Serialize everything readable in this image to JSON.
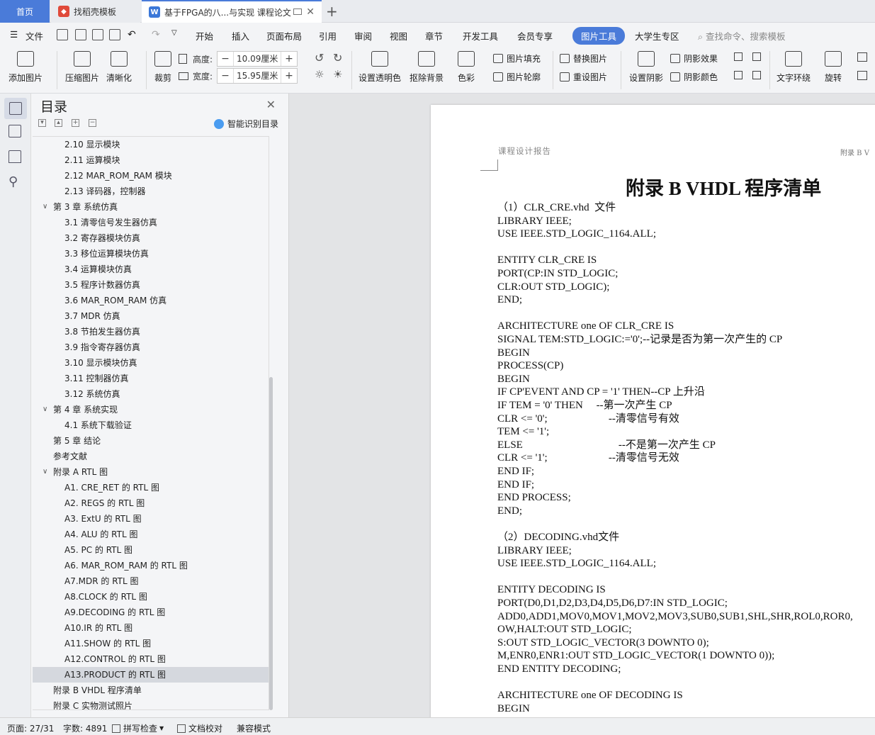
{
  "tabs": {
    "home": "首页",
    "doc1": "找稻壳模板",
    "doc2": "基于FPGA的八...与实现 课程论文",
    "add": "+"
  },
  "menu": {
    "file": "文件",
    "items": [
      "开始",
      "插入",
      "页面布局",
      "引用",
      "审阅",
      "视图",
      "章节",
      "开发工具",
      "会员专享",
      "图片工具",
      "大学生专区"
    ],
    "search": "查找命令、搜索模板"
  },
  "ribbon": {
    "add_image": "添加图片",
    "compress": "压缩图片",
    "sharpen": "清晰化",
    "crop": "裁剪",
    "height_label": "高度:",
    "height_value": "10.09厘米",
    "width_label": "宽度:",
    "width_value": "15.95厘米",
    "transparent": "设置透明色",
    "remove_bg": "抠除背景",
    "color": "色彩",
    "fill": "图片填充",
    "outline": "图片轮廓",
    "replace": "替换图片",
    "reset": "重设图片",
    "shadow_set": "设置阴影",
    "shadow_effect": "阴影效果",
    "shadow_color": "阴影颜色",
    "wrap": "文字环绕",
    "rotate": "旋转"
  },
  "toc": {
    "title": "目录",
    "smart": "智能识别目录",
    "items": [
      {
        "label": "2.10  显示模块",
        "level": 2
      },
      {
        "label": "2.11  运算模块",
        "level": 2
      },
      {
        "label": "2.12 MAR_ROM_RAM 模块",
        "level": 2
      },
      {
        "label": "2.13  译码器，控制器",
        "level": 2
      },
      {
        "label": "第 3 章  系统仿真",
        "level": 1,
        "caret": "∨"
      },
      {
        "label": "3.1  清零信号发生器仿真",
        "level": 2
      },
      {
        "label": "3.2  寄存器模块仿真",
        "level": 2
      },
      {
        "label": "3.3  移位运算模块仿真",
        "level": 2
      },
      {
        "label": "3.4 运算模块仿真",
        "level": 2
      },
      {
        "label": "3.5 程序计数器仿真",
        "level": 2
      },
      {
        "label": "3.6 MAR_ROM_RAM 仿真",
        "level": 2
      },
      {
        "label": "3.7 MDR 仿真",
        "level": 2
      },
      {
        "label": "3.8  节拍发生器仿真",
        "level": 2
      },
      {
        "label": "3.9  指令寄存器仿真",
        "level": 2
      },
      {
        "label": "3.10  显示模块仿真",
        "level": 2
      },
      {
        "label": "3.11  控制器仿真",
        "level": 2
      },
      {
        "label": "3.12 系统仿真",
        "level": 2
      },
      {
        "label": "第 4 章  系统实现",
        "level": 1,
        "caret": "∨"
      },
      {
        "label": "4.1  系统下载验证",
        "level": 2
      },
      {
        "label": "第 5 章  结论",
        "level": 1
      },
      {
        "label": "参考文献",
        "level": 1
      },
      {
        "label": "附录 A RTL 图",
        "level": 1,
        "caret": "∨"
      },
      {
        "label": "A1. CRE_RET 的 RTL 图",
        "level": 2
      },
      {
        "label": "A2. REGS 的 RTL 图",
        "level": 2
      },
      {
        "label": "A3. ExtU 的 RTL 图",
        "level": 2
      },
      {
        "label": "A4. ALU 的 RTL 图",
        "level": 2
      },
      {
        "label": "A5. PC 的 RTL 图",
        "level": 2
      },
      {
        "label": "A6. MAR_ROM_RAM 的 RTL 图",
        "level": 2
      },
      {
        "label": "A7.MDR 的 RTL 图",
        "level": 2
      },
      {
        "label": "A8.CLOCK 的 RTL 图",
        "level": 2
      },
      {
        "label": "A9.DECODING 的 RTL 图",
        "level": 2
      },
      {
        "label": "A10.IR 的 RTL 图",
        "level": 2
      },
      {
        "label": "A11.SHOW 的 RTL 图",
        "level": 2
      },
      {
        "label": "A12.CONTROL 的 RTL 图",
        "level": 2
      },
      {
        "label": "A13.PRODUCT 的 RTL 图",
        "level": 2,
        "selected": true
      },
      {
        "label": "附录 B VHDL 程序清单",
        "level": 1
      },
      {
        "label": "附录 C  实物测试照片",
        "level": 1
      }
    ]
  },
  "document": {
    "header_left": "课程设计报告",
    "header_right": "附录 B   V",
    "title": "附录 B VHDL 程序清单",
    "lines": [
      "（1）CLR_CRE.vhd  文件",
      "LIBRARY IEEE;",
      "USE IEEE.STD_LOGIC_1164.ALL;",
      "",
      "ENTITY CLR_CRE IS",
      "PORT(CP:IN STD_LOGIC;",
      "CLR:OUT STD_LOGIC);",
      "END;",
      "",
      "ARCHITECTURE one OF CLR_CRE IS",
      "SIGNAL TEM:STD_LOGIC:='0';--记录是否为第一次产生的 CP",
      "BEGIN",
      "PROCESS(CP)",
      "BEGIN",
      "IF CP'EVENT AND CP = '1' THEN--CP 上升沿",
      "IF TEM = '0' THEN     --第一次产生 CP",
      "CLR <= '0';                       --清零信号有效",
      "TEM <= '1';",
      "ELSE                                    --不是第一次产生 CP",
      "CLR <= '1';                       --清零信号无效",
      "END IF;",
      "END IF;",
      "END PROCESS;",
      "END;",
      "",
      "（2）DECODING.vhd文件",
      "LIBRARY IEEE;",
      "USE IEEE.STD_LOGIC_1164.ALL;",
      "",
      "ENTITY DECODING IS",
      "PORT(D0,D1,D2,D3,D4,D5,D6,D7:IN STD_LOGIC;",
      "ADD0,ADD1,MOV0,MOV1,MOV2,MOV3,SUB0,SUB1,SHL,SHR,ROL0,ROR0,",
      "OW,HALT:OUT STD_LOGIC;",
      "S:OUT STD_LOGIC_VECTOR(3 DOWNTO 0);",
      "M,ENR0,ENR1:OUT STD_LOGIC_VECTOR(1 DOWNTO 0));",
      "END ENTITY DECODING;",
      "",
      "ARCHITECTURE one OF DECODING IS",
      "BEGIN"
    ]
  },
  "status": {
    "page": "页面: 27/31",
    "words": "字数: 4891",
    "spell": "拼写检查",
    "proof": "文档校对",
    "compat": "兼容模式"
  },
  "colors": {
    "accent": "#4a7bd9",
    "wps_red": "#e04a3a",
    "wps_blue": "#3b78d8"
  }
}
